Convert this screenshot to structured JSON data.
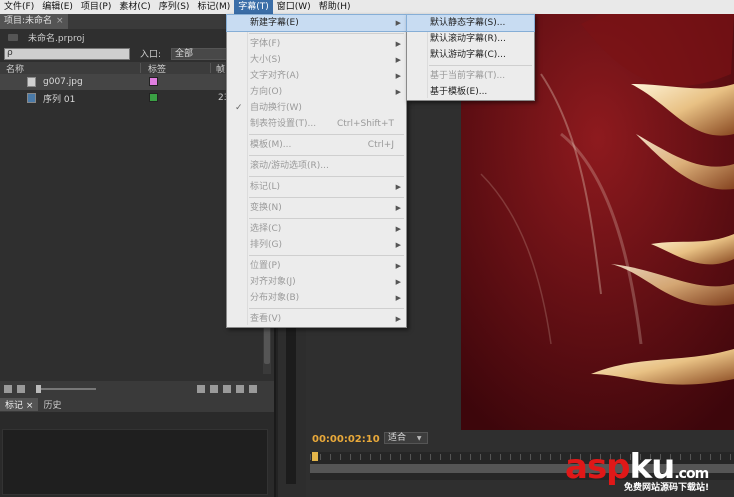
{
  "menubar": [
    "文件(F)",
    "编辑(E)",
    "项目(P)",
    "素材(C)",
    "序列(S)",
    "标记(M)",
    "字幕(T)",
    "窗口(W)",
    "帮助(H)"
  ],
  "project": {
    "tab_label": "项目:未命名",
    "tab_close": "×",
    "path": "未命名.prproj",
    "search_icon": "ρ",
    "entry_label": "入口:",
    "entry_value": "全部",
    "col_name": "名称",
    "col_label": "标签",
    "col_extra": "帧",
    "items": [
      {
        "name": "g007.jpg",
        "color": "#e07ee0",
        "extra": ""
      },
      {
        "name": "序列 01",
        "color": "#3aa044",
        "extra": "23"
      }
    ]
  },
  "markers": {
    "tabs": [
      "标记",
      "历史"
    ],
    "close": "×"
  },
  "monitor": {
    "timecode": "00:00:02:10",
    "fit": "适合",
    "fit_arrow": "▼"
  },
  "title_menu": {
    "items": [
      {
        "label": "新建字幕(E)",
        "shortcut": "",
        "arrow": true,
        "disabled": false,
        "highlight": true,
        "check": false
      },
      {
        "sep": true
      },
      {
        "label": "字体(F)",
        "shortcut": "",
        "arrow": true,
        "disabled": true,
        "highlight": false,
        "check": false
      },
      {
        "label": "大小(S)",
        "shortcut": "",
        "arrow": true,
        "disabled": true,
        "highlight": false,
        "check": false
      },
      {
        "label": "文字对齐(A)",
        "shortcut": "",
        "arrow": true,
        "disabled": true,
        "highlight": false,
        "check": false
      },
      {
        "label": "方向(O)",
        "shortcut": "",
        "arrow": true,
        "disabled": true,
        "highlight": false,
        "check": false
      },
      {
        "label": "自动换行(W)",
        "shortcut": "",
        "arrow": false,
        "disabled": true,
        "highlight": false,
        "check": true
      },
      {
        "label": "制表符设置(T)...",
        "shortcut": "Ctrl+Shift+T",
        "arrow": false,
        "disabled": true,
        "highlight": false,
        "check": false
      },
      {
        "sep": true
      },
      {
        "label": "模板(M)...",
        "shortcut": "Ctrl+J",
        "arrow": false,
        "disabled": true,
        "highlight": false,
        "check": false
      },
      {
        "sep": true
      },
      {
        "label": "滚动/游动选项(R)...",
        "shortcut": "",
        "arrow": false,
        "disabled": true,
        "highlight": false,
        "check": false
      },
      {
        "sep": true
      },
      {
        "label": "标记(L)",
        "shortcut": "",
        "arrow": true,
        "disabled": true,
        "highlight": false,
        "check": false
      },
      {
        "sep": true
      },
      {
        "label": "变换(N)",
        "shortcut": "",
        "arrow": true,
        "disabled": true,
        "highlight": false,
        "check": false
      },
      {
        "sep": true
      },
      {
        "label": "选择(C)",
        "shortcut": "",
        "arrow": true,
        "disabled": true,
        "highlight": false,
        "check": false
      },
      {
        "label": "排列(G)",
        "shortcut": "",
        "arrow": true,
        "disabled": true,
        "highlight": false,
        "check": false
      },
      {
        "sep": true
      },
      {
        "label": "位置(P)",
        "shortcut": "",
        "arrow": true,
        "disabled": true,
        "highlight": false,
        "check": false
      },
      {
        "label": "对齐对象(J)",
        "shortcut": "",
        "arrow": true,
        "disabled": true,
        "highlight": false,
        "check": false
      },
      {
        "label": "分布对象(B)",
        "shortcut": "",
        "arrow": true,
        "disabled": true,
        "highlight": false,
        "check": false
      },
      {
        "sep": true
      },
      {
        "label": "查看(V)",
        "shortcut": "",
        "arrow": true,
        "disabled": true,
        "highlight": false,
        "check": false
      }
    ]
  },
  "new_title_submenu": {
    "items": [
      {
        "label": "默认静态字幕(S)...",
        "disabled": false,
        "highlight": true
      },
      {
        "label": "默认滚动字幕(R)...",
        "disabled": false,
        "highlight": false
      },
      {
        "label": "默认游动字幕(C)...",
        "disabled": false,
        "highlight": false
      },
      {
        "sep": true
      },
      {
        "label": "基于当前字幕(T)...",
        "disabled": true,
        "highlight": false
      },
      {
        "label": "基于模板(E)...",
        "disabled": false,
        "highlight": false
      }
    ]
  },
  "watermark": {
    "asp": "asp",
    "ku": "ku",
    "com": ".com",
    "sub": "免费网站源码下载站!"
  },
  "colors": {
    "accent": "#3b6ea8",
    "timecode": "#e9a93a",
    "watermark_red": "#e01818",
    "image_bg": "#5c0a12"
  }
}
